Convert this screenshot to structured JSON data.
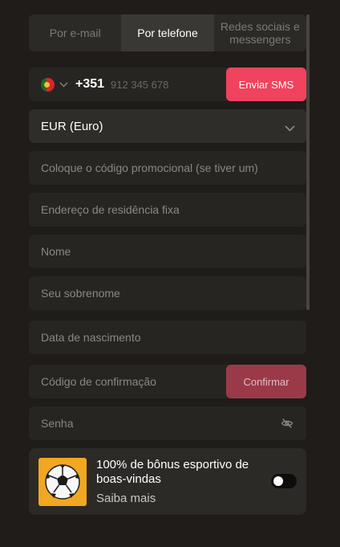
{
  "tabs": [
    {
      "label": "Por e-mail",
      "active": false
    },
    {
      "label": "Por telefone",
      "active": true
    },
    {
      "label": "Redes sociais e messengers",
      "active": false
    }
  ],
  "phone": {
    "flag_icon": "portugal-flag-icon",
    "country_code": "+351",
    "placeholder": "912 345 678",
    "send_label": "Enviar SMS"
  },
  "currency": {
    "selected": "EUR (Euro)"
  },
  "fields": {
    "promo": "Coloque o código promocional (se tiver um)",
    "address": "Endereço de residência fixa",
    "first_name": "Nome",
    "last_name": "Seu sobrenome",
    "birth_date": "Data de nascimento",
    "confirmation_code": "Código de confirmação",
    "password": "Senha"
  },
  "confirm_label": "Confirmar",
  "bonus": {
    "title": "100% de bônus esportivo de boas-vindas",
    "link": "Saiba mais",
    "icon": "soccer-ball-icon",
    "toggle_on": false
  },
  "colors": {
    "accent": "#f0435d",
    "confirm": "#9a3a48",
    "bonus_icon_bg": "#f2a722"
  }
}
